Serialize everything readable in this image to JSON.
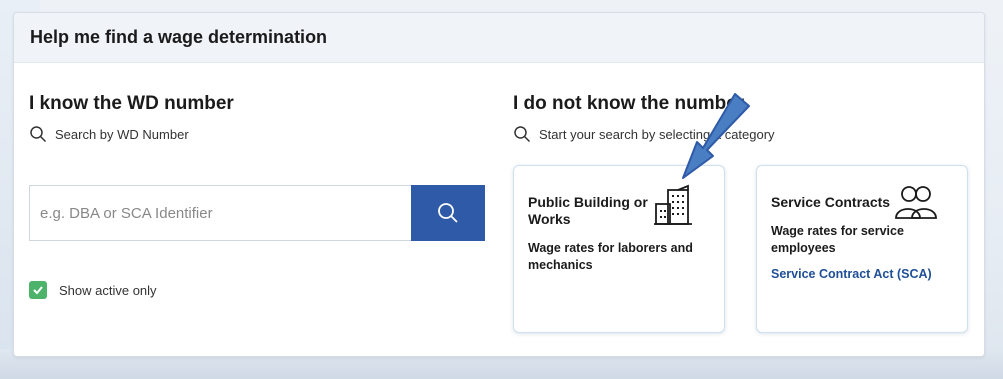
{
  "panel": {
    "title": "Help me find a wage determination"
  },
  "left": {
    "title": "I know the WD number",
    "hint": "Search by WD Number",
    "search_placeholder": "e.g. DBA or SCA Identifier",
    "checkbox_label": "Show active only",
    "checkbox_checked": true
  },
  "right": {
    "title": "I do not know the number",
    "hint": "Start your search by selecting a category",
    "cards": [
      {
        "title": "Public Building or Works",
        "desc": "Wage rates for laborers and mechanics",
        "icon": "building-icon"
      },
      {
        "title": "Service Contracts",
        "desc": "Wage rates for service employees",
        "link": "Service Contract Act (SCA)",
        "icon": "people-icon"
      }
    ]
  },
  "colors": {
    "primary": "#2f5aa8",
    "check": "#4db26a",
    "link": "#1f4f96",
    "arrow": "#4a7ec2"
  }
}
